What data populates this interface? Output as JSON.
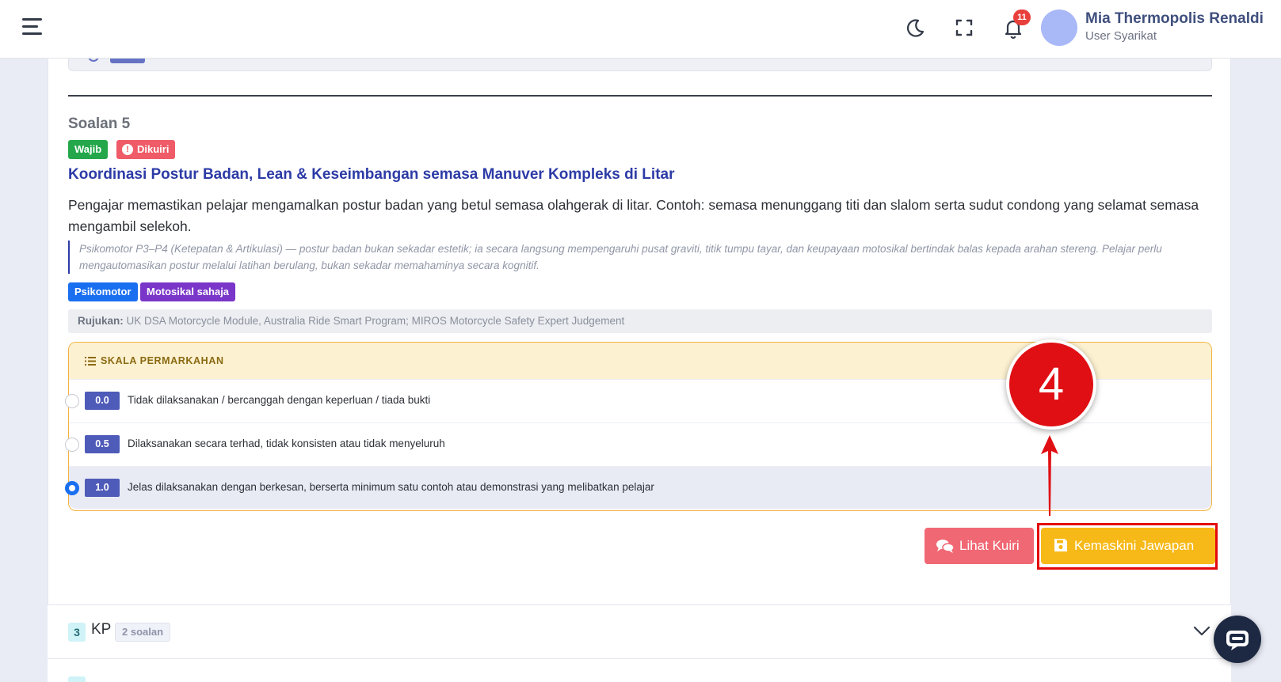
{
  "header": {
    "user_name": "Mia Thermopolis Renaldi",
    "user_role": "User Syarikat",
    "notification_count": "11",
    "icons": [
      "hamburger-menu-icon",
      "moon-icon",
      "fullscreen-icon",
      "bell-icon"
    ]
  },
  "question": {
    "number_label": "Soalan 5",
    "badge_wajib": "Wajib",
    "badge_dikuiri": "Dikuiri",
    "title": "Koordinasi Postur Badan, Lean & Keseimbangan semasa Manuver Kompleks di Litar",
    "description": "Pengajar memastikan pelajar mengamalkan postur badan yang betul semasa olahgerak di litar. Contoh: semasa menunggang titi dan slalom serta sudut condong yang selamat semasa mengambil selekoh.",
    "note": "Psikomotor P3–P4 (Ketepatan & Artikulasi) — postur badan bukan sekadar estetik; ia secara langsung mempengaruhi pusat graviti, titik tumpu tayar, dan keupayaan motosikal bertindak balas kepada arahan stereng. Pelajar perlu mengautomasikan postur melalui latihan berulang, bukan sekadar memahaminya secara kognitif.",
    "tags": [
      "Psikomotor",
      "Motosikal sahaja"
    ],
    "rujukan_label": "Rujukan:",
    "rujukan_text": " UK DSA Motorcycle Module, Australia Ride Smart Program; MIROS Motorcycle Safety Expert Judgement"
  },
  "skala": {
    "title": "SKALA PERMARKAHAN",
    "options": [
      {
        "score": "0.0",
        "label": "Tidak dilaksanakan / bercanggah dengan keperluan / tiada bukti",
        "selected": false
      },
      {
        "score": "0.5",
        "label": "Dilaksanakan secara terhad, tidak konsisten atau tidak menyeluruh",
        "selected": false
      },
      {
        "score": "1.0",
        "label": "Jelas dilaksanakan dengan berkesan, berserta minimum satu contoh atau demonstrasi yang melibatkan pelajar",
        "selected": true
      }
    ]
  },
  "actions": {
    "lihat_kuiri": "Lihat Kuiri",
    "kemaskini": "Kemaskini Jawapan"
  },
  "annotation": {
    "step_number": "4",
    "color": "#e00f14"
  },
  "sections": [
    {
      "number": "3",
      "title": "KP",
      "count": "2 soalan"
    }
  ],
  "colors": {
    "accent_blue": "#2d3ba6",
    "warning_yellow": "#f7b918",
    "danger_pink": "#f06874"
  }
}
